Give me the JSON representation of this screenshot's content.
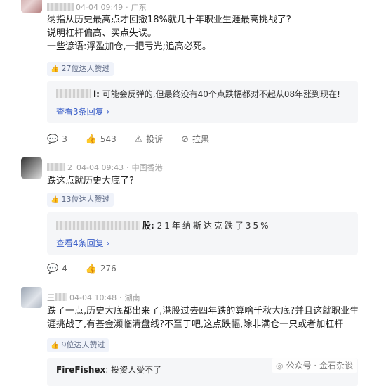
{
  "comments": [
    {
      "name_masked": "",
      "date": "04-04 09:49",
      "location": "广东",
      "lines": [
        "纳指从历史最高点才回撤18%就几十年职业生涯最高挑战了?",
        "说明杠杆偏高、买点失误。",
        "一些谚语:浮盈加仓,一把亏光;追高必死。"
      ],
      "badge": "27位达人赞过",
      "reply_name": "",
      "reply_text": "可能会反弹的,但最终没有40个点跌幅都对不起从08年涨到现在!",
      "view_more": "查看3条回复",
      "comment_count": "3",
      "like_count": "543",
      "report_label": "投诉",
      "block_label": "拉黑"
    },
    {
      "name_suffix": "2",
      "date": "04-04 09:43",
      "location": "中国香港",
      "lines": [
        "跌这点就历史大底了?"
      ],
      "badge": "13位达人赞过",
      "reply_name": "股:",
      "reply_text": "21年纳斯达克跌了35%",
      "view_more": "查看4条回复",
      "comment_count": "4",
      "like_count": "276"
    },
    {
      "name_suffix": "王",
      "date": "04-04 10:48",
      "location": "湖南",
      "lines": [
        "跌了一点,历史大底都出来了,港股过去四年跌的算啥千秋大底?并且这就职业生",
        "涯挑战了,有基金濒临清盘线?不至于吧,这点跌幅,除非满仓一只或者加杠杆"
      ],
      "badge": "9位达人赞过",
      "reply_name": "FireFishex",
      "reply_text": "投资人受不了"
    }
  ],
  "watermark": {
    "prefix": "公众号 ·",
    "name": "金石杂谈"
  }
}
